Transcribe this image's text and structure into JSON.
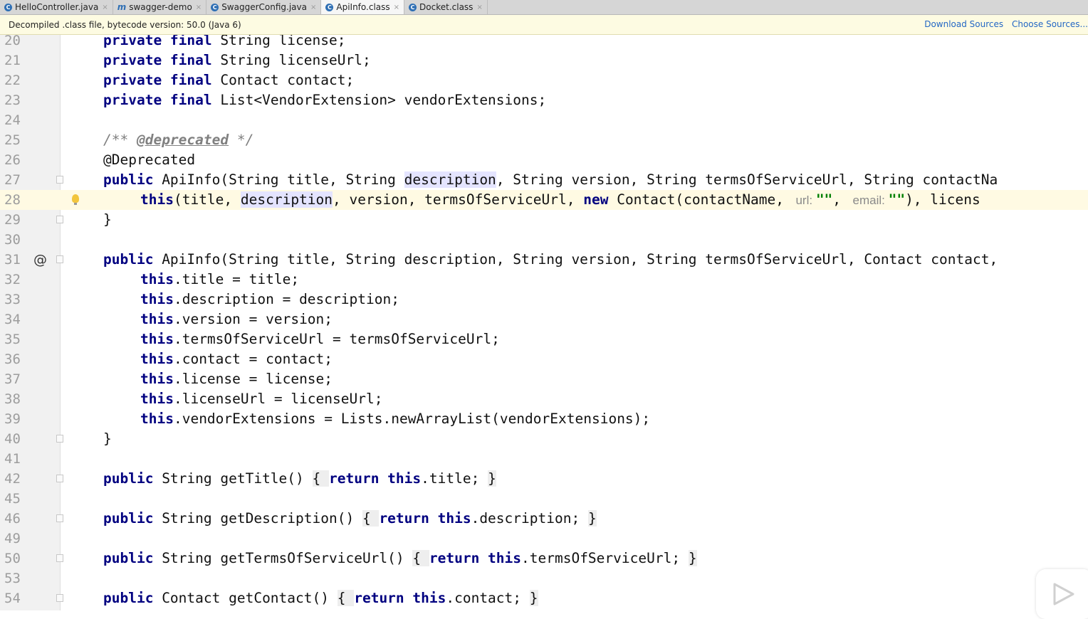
{
  "tabs": [
    {
      "label": "HelloController.java",
      "icon": "class-icon",
      "icon_glyph": "C",
      "active": false
    },
    {
      "label": "swagger-demo",
      "icon": "module-icon",
      "icon_glyph": "m",
      "active": false
    },
    {
      "label": "SwaggerConfig.java",
      "icon": "class-icon",
      "icon_glyph": "C",
      "active": false
    },
    {
      "label": "ApiInfo.class",
      "icon": "class-icon",
      "icon_glyph": "C",
      "active": true
    },
    {
      "label": "Docket.class",
      "icon": "class-icon",
      "icon_glyph": "C",
      "active": false
    }
  ],
  "notice": {
    "text": "Decompiled .class file, bytecode version: 50.0 (Java 6)",
    "download_sources": "Download Sources",
    "choose_sources": "Choose Sources..."
  },
  "editor": {
    "current_line": "28",
    "lines": [
      {
        "n": "20",
        "tokens": [
          [
            "kw",
            "private final "
          ],
          [
            "",
            "String license;"
          ]
        ]
      },
      {
        "n": "21",
        "tokens": [
          [
            "kw",
            "private final "
          ],
          [
            "",
            "String licenseUrl;"
          ]
        ]
      },
      {
        "n": "22",
        "tokens": [
          [
            "kw",
            "private final "
          ],
          [
            "",
            "Contact contact;"
          ]
        ]
      },
      {
        "n": "23",
        "tokens": [
          [
            "kw",
            "private final "
          ],
          [
            "",
            "List<VendorExtension> vendorExtensions;"
          ]
        ]
      },
      {
        "n": "24",
        "tokens": []
      },
      {
        "n": "25",
        "tokens": [
          [
            "cm",
            "/** "
          ],
          [
            "doc",
            "@deprecated"
          ],
          [
            "cm",
            " */"
          ]
        ]
      },
      {
        "n": "26",
        "tokens": [
          [
            "",
            "@Deprecated"
          ]
        ]
      },
      {
        "n": "27",
        "tokens": [
          [
            "kw",
            "public "
          ],
          [
            "",
            "ApiInfo(String title, String "
          ],
          [
            "hl",
            "description"
          ],
          [
            "",
            ", String version, String termsOfServiceUrl, String contactNa"
          ]
        ]
      },
      {
        "n": "28",
        "indent": 2,
        "tokens": [
          [
            "kw",
            "this"
          ],
          [
            "",
            "(title, "
          ],
          [
            "hl",
            "description"
          ],
          [
            "",
            ", version, termsOfServiceUrl, "
          ],
          [
            "kw",
            "new "
          ],
          [
            "",
            "Contact(contactName, "
          ],
          [
            "hint",
            " url: "
          ],
          [
            "str",
            "\"\""
          ],
          [
            "",
            ", "
          ],
          [
            "hint",
            " email: "
          ],
          [
            "str",
            "\"\""
          ],
          [
            "",
            "), licens"
          ]
        ]
      },
      {
        "n": "29",
        "tokens": [
          [
            "",
            "}"
          ]
        ]
      },
      {
        "n": "30",
        "tokens": []
      },
      {
        "n": "31",
        "tokens": [
          [
            "kw",
            "public "
          ],
          [
            "",
            "ApiInfo(String title, String description, String version, String termsOfServiceUrl, Contact contact,"
          ]
        ]
      },
      {
        "n": "32",
        "indent": 2,
        "tokens": [
          [
            "kw",
            "this"
          ],
          [
            "",
            ".title = title;"
          ]
        ]
      },
      {
        "n": "33",
        "indent": 2,
        "tokens": [
          [
            "kw",
            "this"
          ],
          [
            "",
            ".description = description;"
          ]
        ]
      },
      {
        "n": "34",
        "indent": 2,
        "tokens": [
          [
            "kw",
            "this"
          ],
          [
            "",
            ".version = version;"
          ]
        ]
      },
      {
        "n": "35",
        "indent": 2,
        "tokens": [
          [
            "kw",
            "this"
          ],
          [
            "",
            ".termsOfServiceUrl = termsOfServiceUrl;"
          ]
        ]
      },
      {
        "n": "36",
        "indent": 2,
        "tokens": [
          [
            "kw",
            "this"
          ],
          [
            "",
            ".contact = contact;"
          ]
        ]
      },
      {
        "n": "37",
        "indent": 2,
        "tokens": [
          [
            "kw",
            "this"
          ],
          [
            "",
            ".license = license;"
          ]
        ]
      },
      {
        "n": "38",
        "indent": 2,
        "tokens": [
          [
            "kw",
            "this"
          ],
          [
            "",
            ".licenseUrl = licenseUrl;"
          ]
        ]
      },
      {
        "n": "39",
        "indent": 2,
        "tokens": [
          [
            "kw",
            "this"
          ],
          [
            "",
            ".vendorExtensions = Lists.newArrayList(vendorExtensions);"
          ]
        ]
      },
      {
        "n": "40",
        "tokens": [
          [
            "",
            "}"
          ]
        ]
      },
      {
        "n": "41",
        "tokens": []
      },
      {
        "n": "42",
        "tokens": [
          [
            "kw",
            "public "
          ],
          [
            "",
            "String getTitle() "
          ],
          [
            "fold-region",
            "{ "
          ],
          [
            "kw",
            "return this"
          ],
          [
            "",
            ".title; "
          ],
          [
            "fold-region",
            "}"
          ]
        ]
      },
      {
        "n": "45",
        "tokens": []
      },
      {
        "n": "46",
        "tokens": [
          [
            "kw",
            "public "
          ],
          [
            "",
            "String getDescription() "
          ],
          [
            "fold-region",
            "{ "
          ],
          [
            "kw",
            "return this"
          ],
          [
            "",
            ".description; "
          ],
          [
            "fold-region",
            "}"
          ]
        ]
      },
      {
        "n": "49",
        "tokens": []
      },
      {
        "n": "50",
        "tokens": [
          [
            "kw",
            "public "
          ],
          [
            "",
            "String getTermsOfServiceUrl() "
          ],
          [
            "fold-region",
            "{ "
          ],
          [
            "kw",
            "return this"
          ],
          [
            "",
            ".termsOfServiceUrl; "
          ],
          [
            "fold-region",
            "}"
          ]
        ]
      },
      {
        "n": "53",
        "tokens": []
      },
      {
        "n": "54",
        "tokens": [
          [
            "kw",
            "public "
          ],
          [
            "",
            "Contact getContact() "
          ],
          [
            "fold-region",
            "{ "
          ],
          [
            "kw",
            "return this"
          ],
          [
            "",
            ".contact; "
          ],
          [
            "fold-region",
            "}"
          ]
        ]
      }
    ],
    "gutter": {
      "override_marker_line": "31",
      "override_marker_glyph": "@",
      "intention_bulb_line": "28",
      "fold_lines": [
        "27",
        "29",
        "31",
        "40",
        "42",
        "46",
        "50",
        "54"
      ]
    }
  },
  "colors": {
    "keyword": "#000080",
    "comment": "#808080",
    "string": "#008000",
    "hint": "#8a8a8a",
    "link": "#2467c4",
    "notice_bg": "#fdfbe2",
    "current_line_bg": "#fffae3"
  }
}
